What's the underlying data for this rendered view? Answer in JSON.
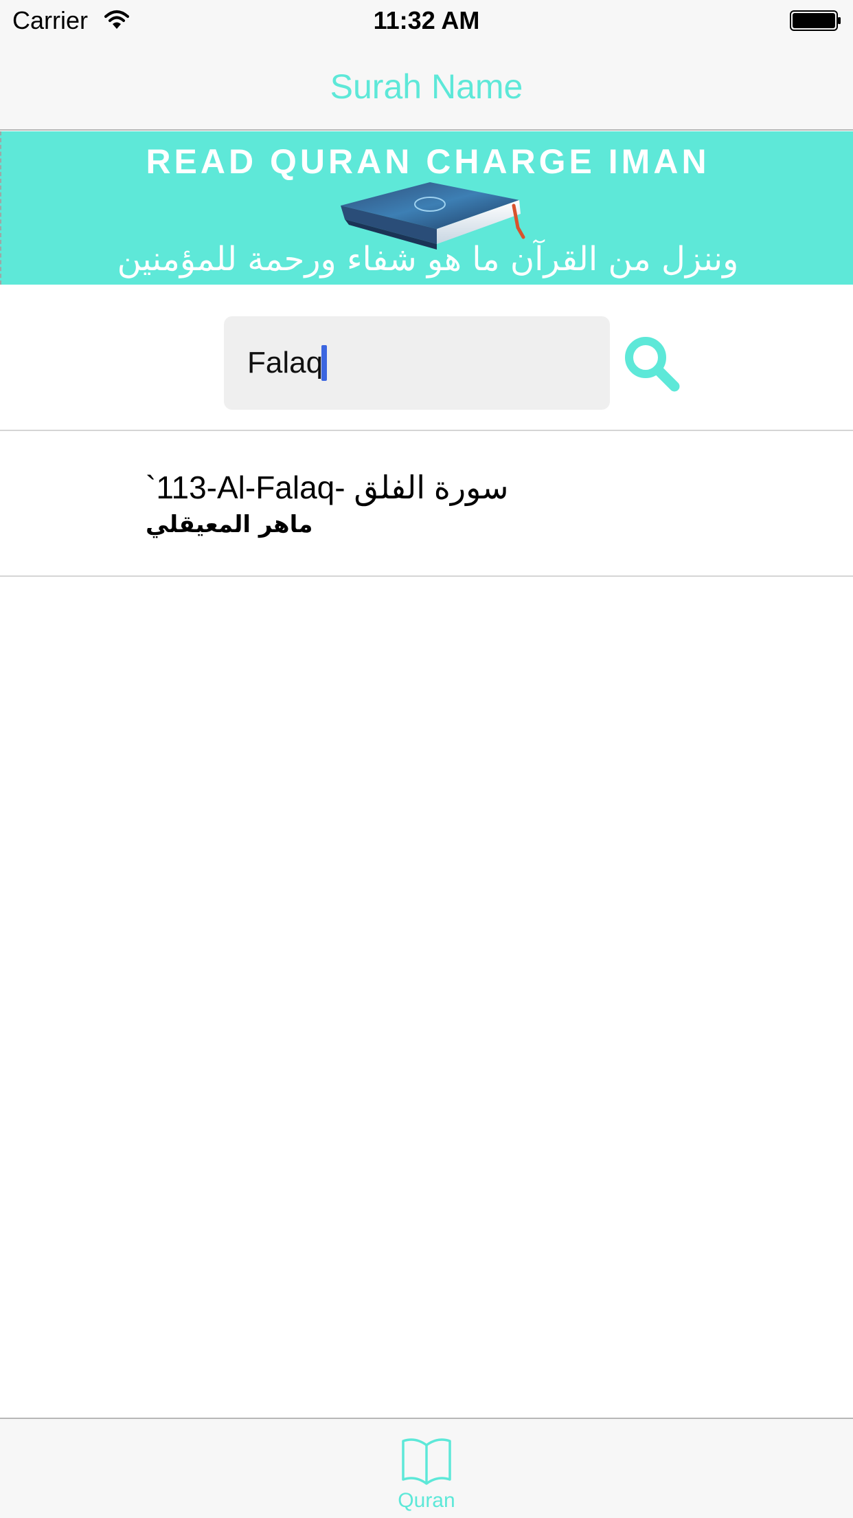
{
  "status_bar": {
    "carrier": "Carrier",
    "time": "11:32 AM"
  },
  "nav": {
    "title": "Surah Name"
  },
  "banner": {
    "headline": "READ QURAN CHARGE IMAN",
    "arabic_verse": "وننزل من القرآن ما هو شفاء ورحمة للمؤمنين"
  },
  "search": {
    "value": "Falaq",
    "icon": "search-icon"
  },
  "results": [
    {
      "title": "`113-Al-Falaq- سورة الفلق",
      "subtitle": "ماهر المعيقلي"
    }
  ],
  "tab_bar": {
    "tabs": [
      {
        "label": "Quran",
        "icon": "book-open-icon",
        "selected": true
      }
    ]
  },
  "colors": {
    "accent": "#5de8d8",
    "banner_background": "#5ee8d8",
    "bar_background": "#f7f7f7",
    "search_field_background": "#efefef",
    "caret": "#3c66e0"
  }
}
